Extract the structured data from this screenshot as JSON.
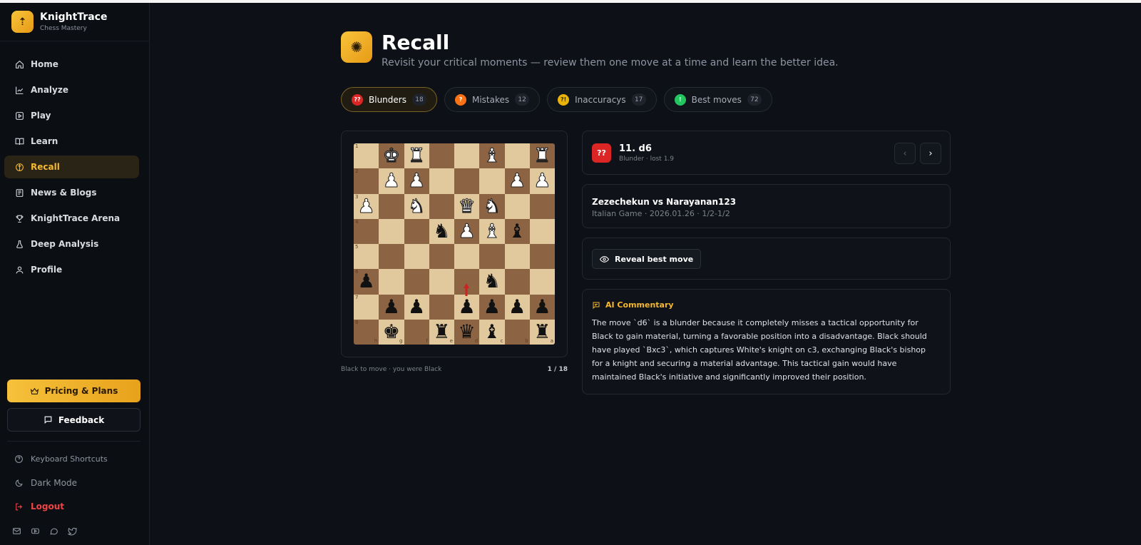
{
  "app": {
    "name": "KnightTrace",
    "tagline": "Chess Mastery"
  },
  "sidebar": {
    "items": [
      {
        "label": "Home",
        "icon": "home-icon"
      },
      {
        "label": "Analyze",
        "icon": "chart-icon"
      },
      {
        "label": "Play",
        "icon": "play-icon"
      },
      {
        "label": "Learn",
        "icon": "book-icon"
      },
      {
        "label": "Recall",
        "icon": "brain-icon",
        "active": true
      },
      {
        "label": "News & Blogs",
        "icon": "newspaper-icon"
      },
      {
        "label": "KnightTrace Arena",
        "icon": "trophy-icon"
      },
      {
        "label": "Deep Analysis",
        "icon": "flask-icon"
      },
      {
        "label": "Profile",
        "icon": "user-icon"
      }
    ],
    "pricing_label": "Pricing & Plans",
    "feedback_label": "Feedback",
    "shortcuts_label": "Keyboard Shortcuts",
    "darkmode_label": "Dark Mode",
    "logout_label": "Logout"
  },
  "page": {
    "title": "Recall",
    "subtitle": "Revisit your critical moments — review them one move at a time and learn the better idea."
  },
  "tabs": [
    {
      "label": "Blunders",
      "count": "18",
      "badge": "??",
      "color": "#dc2626",
      "active": true
    },
    {
      "label": "Mistakes",
      "count": "12",
      "badge": "?",
      "color": "#f97316"
    },
    {
      "label": "Inaccuracys",
      "count": "17",
      "badge": "?!",
      "color": "#eab308"
    },
    {
      "label": "Best moves",
      "count": "72",
      "badge": "!",
      "color": "#22c55e"
    }
  ],
  "board": {
    "ranks": [
      "1",
      "2",
      "3",
      "4",
      "5",
      "6",
      "7",
      "8"
    ],
    "files": [
      "h",
      "g",
      "f",
      "e",
      "d",
      "c",
      "b",
      "a"
    ],
    "pieces": [
      "",
      "wK",
      "wR",
      "",
      "",
      "wB",
      "",
      "wR",
      "",
      "wP",
      "wP",
      "",
      "",
      "",
      "wP",
      "wP",
      "wP",
      "",
      "wN",
      "",
      "wQ",
      "wN",
      "",
      "",
      "",
      "",
      "",
      "bN",
      "wP",
      "wB",
      "bB",
      "",
      "",
      "",
      "",
      "",
      "",
      "",
      "",
      "",
      "bP",
      "",
      "",
      "",
      "",
      "bN",
      "",
      "",
      "",
      "bP",
      "bP",
      "",
      "bP",
      "bP",
      "bP",
      "bP",
      "",
      "bK",
      "",
      "bR",
      "bQ",
      "bB",
      "",
      "bR"
    ],
    "status": "Black to move · you were Black",
    "position": "1 / 18"
  },
  "move": {
    "badge": "??",
    "title": "11. d6",
    "subtitle": "Blunder · lost 1.9"
  },
  "game": {
    "players": "Zezechekun vs Narayanan123",
    "info": "Italian Game · 2026.01.26 · 1/2-1/2"
  },
  "reveal_label": "Reveal best move",
  "ai": {
    "title": "AI Commentary",
    "body": "The move `d6` is a blunder because it completely misses a tactical opportunity for Black to gain material, turning a favorable position into a disadvantage. Black should have played `Bxc3`, which captures White's knight on c3, exchanging Black's bishop for a knight and securing a material advantage. This tactical gain would have maintained Black's initiative and significantly improved their position."
  },
  "colors": {
    "accent": "#f5b82e",
    "blunder": "#dc2626",
    "board_light": "#e2c89d",
    "board_dark": "#8c6444"
  }
}
